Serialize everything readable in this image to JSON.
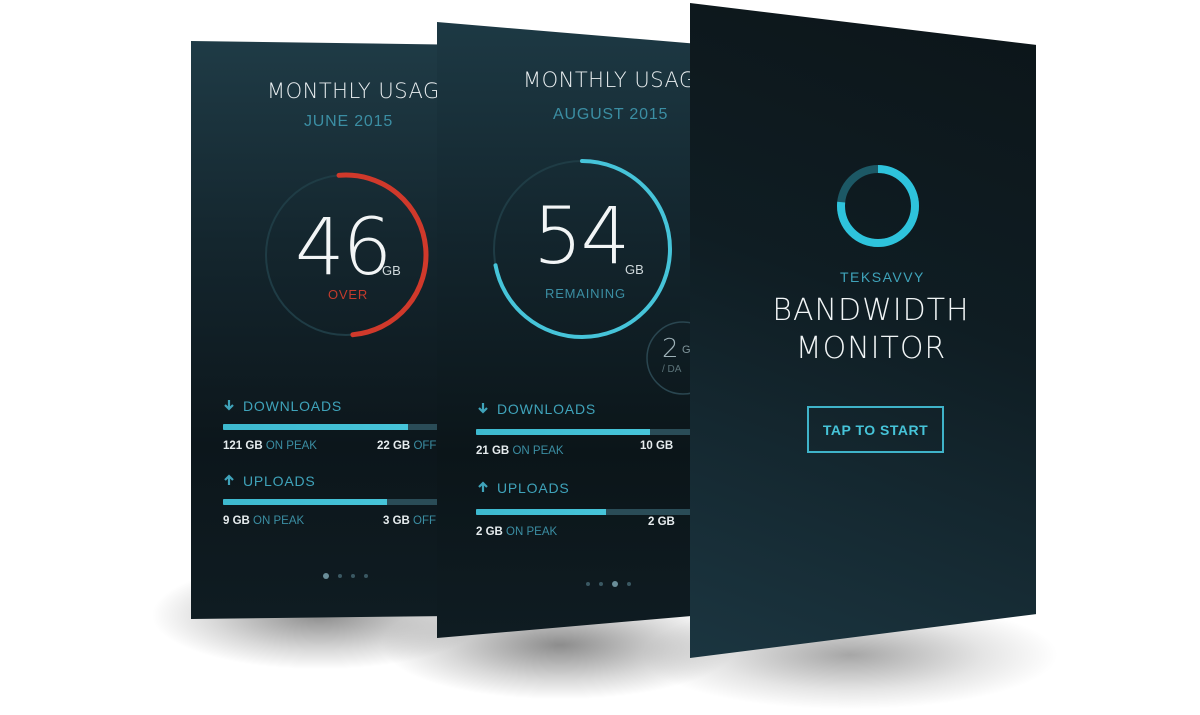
{
  "panel_june": {
    "title": "MONTHLY USAGE",
    "month": "JUNE 2015",
    "usage_number": "46",
    "usage_unit": "GB",
    "usage_state": "OVER",
    "ring_fraction": 0.5,
    "ring_color": "#d0392b",
    "downloads": {
      "label": "DOWNLOADS",
      "on_peak_amount": "121 GB",
      "on_peak_label": "ON PEAK",
      "off_peak_amount": "22 GB",
      "off_peak_label": "OFF",
      "fill_fraction": 0.85
    },
    "uploads": {
      "label": "UPLOADS",
      "on_peak_amount": "9 GB",
      "on_peak_label": "ON PEAK",
      "off_peak_amount": "3 GB",
      "off_peak_label": "OFF",
      "fill_fraction": 0.75
    },
    "page_dots": {
      "count": 4,
      "active": 0
    }
  },
  "panel_august": {
    "title": "MONTHLY USAGE",
    "month": "AUGUST 2015",
    "usage_number": "54",
    "usage_unit": "GB",
    "usage_state": "REMAINING",
    "ring_fraction": 0.72,
    "ring_color": "#46c4d9",
    "side_dial_number": "2",
    "side_dial_unit": "G",
    "side_dial_label": "/ DA",
    "downloads": {
      "label": "DOWNLOADS",
      "on_peak_amount": "21 GB",
      "on_peak_label": "ON PEAK",
      "off_peak_amount": "10 GB",
      "off_peak_label": "",
      "fill_fraction": 0.8
    },
    "uploads": {
      "label": "UPLOADS",
      "on_peak_amount": "2 GB",
      "on_peak_label": "ON PEAK",
      "off_peak_amount": "2 GB",
      "off_peak_label": "",
      "fill_fraction": 0.6
    },
    "page_dots": {
      "count": 4,
      "active": 2
    }
  },
  "panel_start": {
    "brand": "TEKSAVVY",
    "hero_line1": "BANDWIDTH",
    "hero_line2": "MONITOR",
    "cta_label": "TAP TO START",
    "logo_icon": "ring-logo-icon",
    "accent_color": "#46c4d9"
  }
}
